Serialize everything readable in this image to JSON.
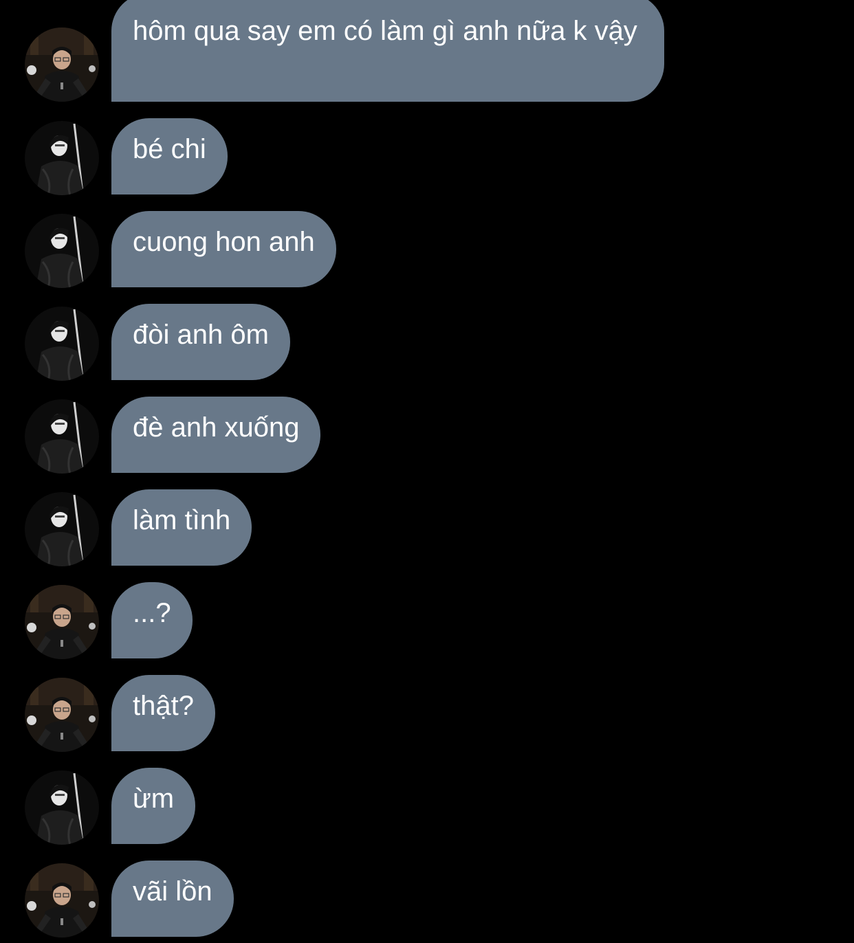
{
  "messages": [
    {
      "sender": "a",
      "text": "hôm qua say em có làm gì anh nữa k vậy"
    },
    {
      "sender": "b",
      "text": "bé chi"
    },
    {
      "sender": "b",
      "text": "cuong hon anh"
    },
    {
      "sender": "b",
      "text": "đòi anh ôm"
    },
    {
      "sender": "b",
      "text": "đè anh xuống"
    },
    {
      "sender": "b",
      "text": "làm tình"
    },
    {
      "sender": "a",
      "text": "...?"
    },
    {
      "sender": "a",
      "text": "thật?"
    },
    {
      "sender": "b",
      "text": "ừm"
    },
    {
      "sender": "a",
      "text": "vãi lồn"
    }
  ],
  "colors": {
    "background": "#000000",
    "bubble": "#687889",
    "bubble_text": "#ffffff"
  }
}
